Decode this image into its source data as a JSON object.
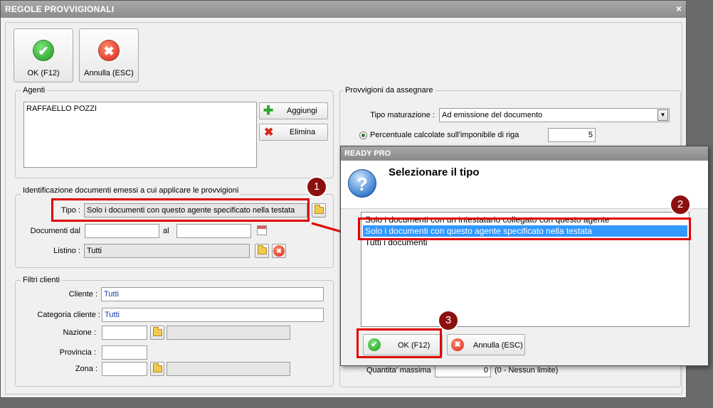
{
  "window": {
    "title": "REGOLE PROVVIGIONALI",
    "close_glyph": "×"
  },
  "toolbar": {
    "ok_label": "OK (F12)",
    "cancel_label": "Annulla (ESC)"
  },
  "agenti": {
    "group_label": "Agenti",
    "list": [
      "RAFFAELLO POZZI"
    ],
    "add_label": "Aggiungi",
    "remove_label": "Elimina"
  },
  "identificazione": {
    "group_label": "Identificazione documenti emessi a cui applicare le provvigioni",
    "tipo_label": "Tipo :",
    "tipo_value": "Solo i documenti con questo agente specificato nella testata",
    "documenti_dal_label": "Documenti dal",
    "al_label": "al",
    "listino_label": "Listino :",
    "listino_value": "Tutti"
  },
  "filtri": {
    "group_label": "Filtri clienti",
    "cliente_label": "Cliente :",
    "cliente_value": "Tutti",
    "categoria_label": "Categoria cliente :",
    "categoria_value": "Tutti",
    "nazione_label": "Nazione :",
    "provincia_label": "Provincia :",
    "zona_label": "Zona :"
  },
  "provvigioni": {
    "group_label": "Provvigioni da assegnare",
    "tipo_maturazione_label": "Tipo maturazione :",
    "tipo_maturazione_value": "Ad emissione del documento",
    "percentuale_label": "Percentuale calcolate sull'imponibile di riga",
    "percentuale_value": "5",
    "quantita_label": "Quantita' massima",
    "quantita_value": "0",
    "quantita_note": "(0 - Nessun limite)"
  },
  "dialog": {
    "title": "READY PRO",
    "heading": "Selezionare il tipo",
    "options": [
      "Solo i documenti con un intestatario collegato con questo agente",
      "Solo i documenti con questo agente specificato nella testata",
      "Tutti i documenti"
    ],
    "selected_index": 1,
    "ok_label": "OK (F12)",
    "cancel_label": "Annulla (ESC)"
  },
  "annotations": {
    "badge1": "1",
    "badge2": "2",
    "badge3": "3"
  },
  "colors": {
    "highlight_red": "#e00000",
    "badge_bg": "#8c0f0f",
    "selection_blue": "#3399ff"
  }
}
